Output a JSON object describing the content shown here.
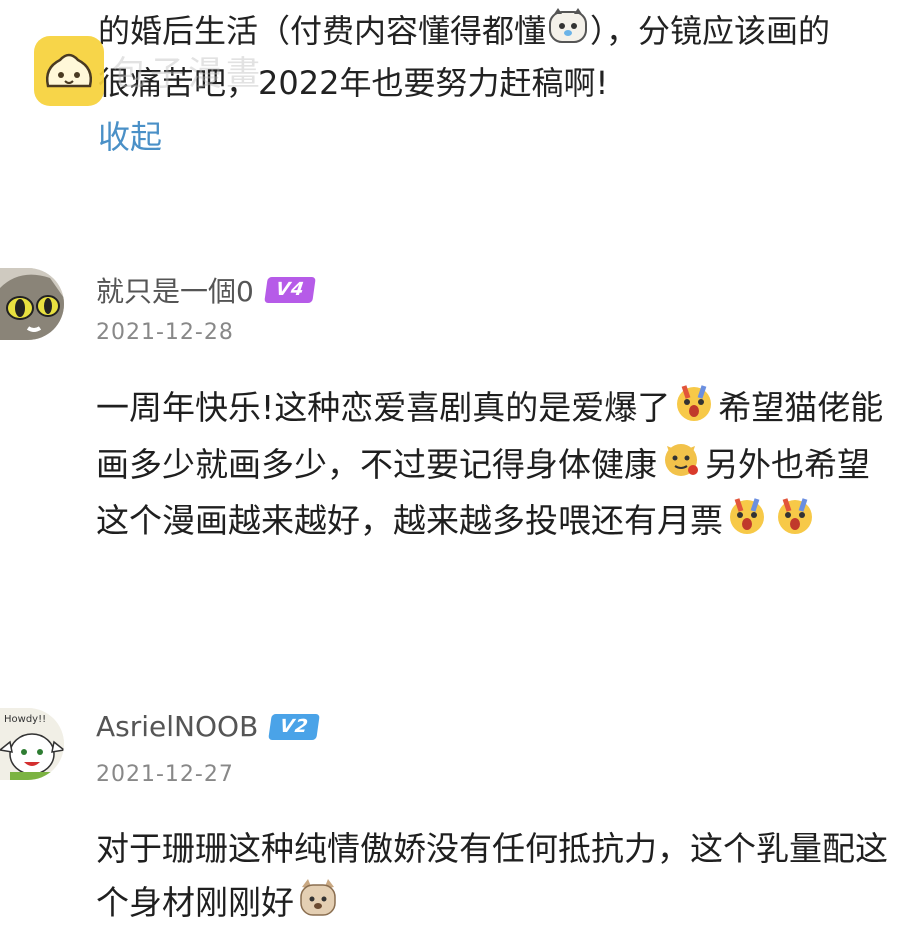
{
  "watermark": {
    "text": "包子漫畫"
  },
  "previous_comment": {
    "text_line1": "的婚后生活（付费内容懂得都懂",
    "text_line1_tail": "），分镜应该画的",
    "text_line2": "很痛苦吧，2022年也要努力赶稿啊!",
    "collapse_label": "收起"
  },
  "comments": [
    {
      "username": "就只是一個0",
      "level": "V4",
      "level_color": "#b65be8",
      "date": "2021-12-28",
      "text_a": "一周年快乐!这种恋爱喜剧真的是爱爆了",
      "text_b": "希望猫佬能画多少就画多少，不过要记得身体健康",
      "text_c": "另外也希望这个漫画越来越好，越来越多投喂还有月票",
      "avatar_icon": "cat-avatar-icon"
    },
    {
      "username": "AsrielNOOB",
      "level": "V2",
      "level_color": "#4aa3e8",
      "date": "2021-12-27",
      "text_a": "对于珊珊这种纯情傲娇没有任何抵抗力，这个乳量配这个身材刚刚好",
      "avatar_icon": "goat-avatar-icon",
      "avatar_caption": "Howdy!!"
    }
  ],
  "colors": {
    "link": "#4a90c7",
    "logo_yellow": "#f7d23a"
  }
}
